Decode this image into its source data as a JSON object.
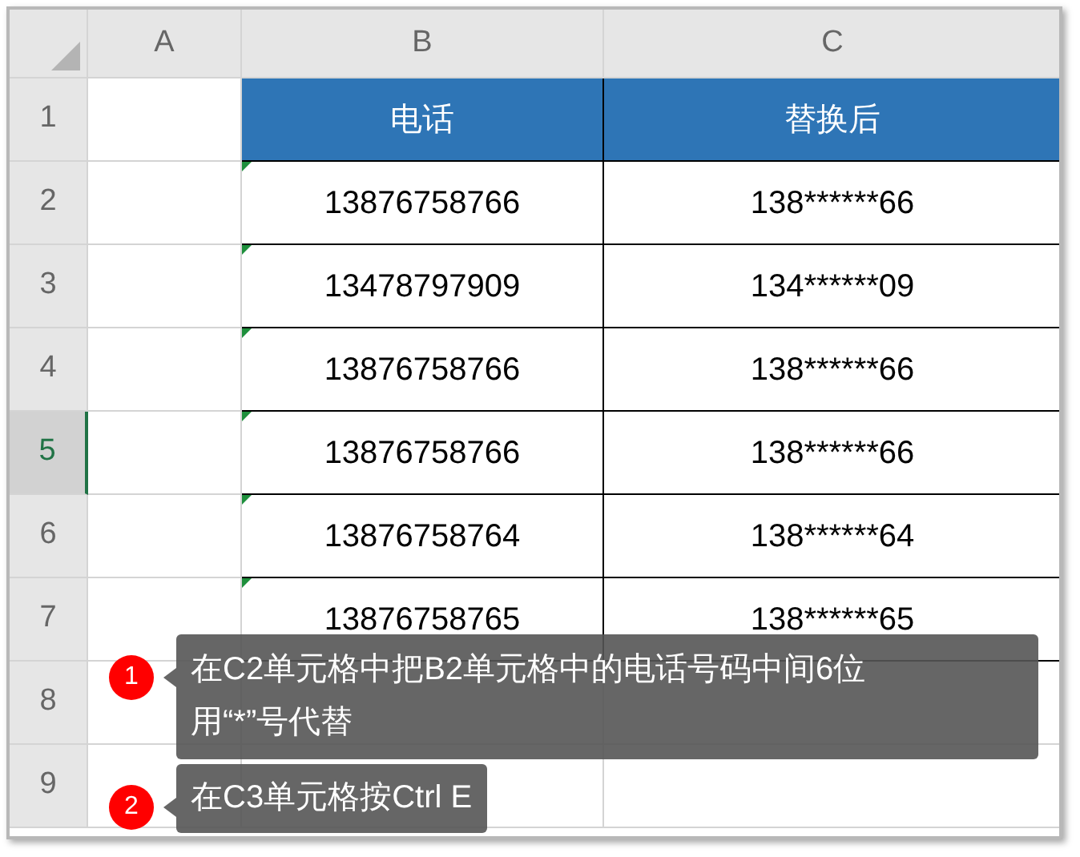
{
  "columns": [
    "A",
    "B",
    "C"
  ],
  "header_row": {
    "row": "1",
    "cells": [
      "",
      "电话",
      "替换后"
    ]
  },
  "rows": [
    {
      "row": "2",
      "selected": false,
      "flagged": true,
      "phone": "13876758766",
      "masked": "138******66"
    },
    {
      "row": "3",
      "selected": false,
      "flagged": true,
      "phone": "13478797909",
      "masked": "134******09"
    },
    {
      "row": "4",
      "selected": false,
      "flagged": true,
      "phone": "13876758766",
      "masked": "138******66"
    },
    {
      "row": "5",
      "selected": true,
      "flagged": true,
      "phone": "13876758766",
      "masked": "138******66"
    },
    {
      "row": "6",
      "selected": false,
      "flagged": true,
      "phone": "13876758764",
      "masked": "138******64"
    },
    {
      "row": "7",
      "selected": false,
      "flagged": true,
      "phone": "13876758765",
      "masked": "138******65"
    }
  ],
  "empty_rows": [
    "8",
    "9"
  ],
  "callouts": [
    {
      "number": "1",
      "text": "在C2单元格中把B2单元格中的电话号码中间6位用“*”号代替"
    },
    {
      "number": "2",
      "text": "在C3单元格按Ctrl E"
    }
  ]
}
